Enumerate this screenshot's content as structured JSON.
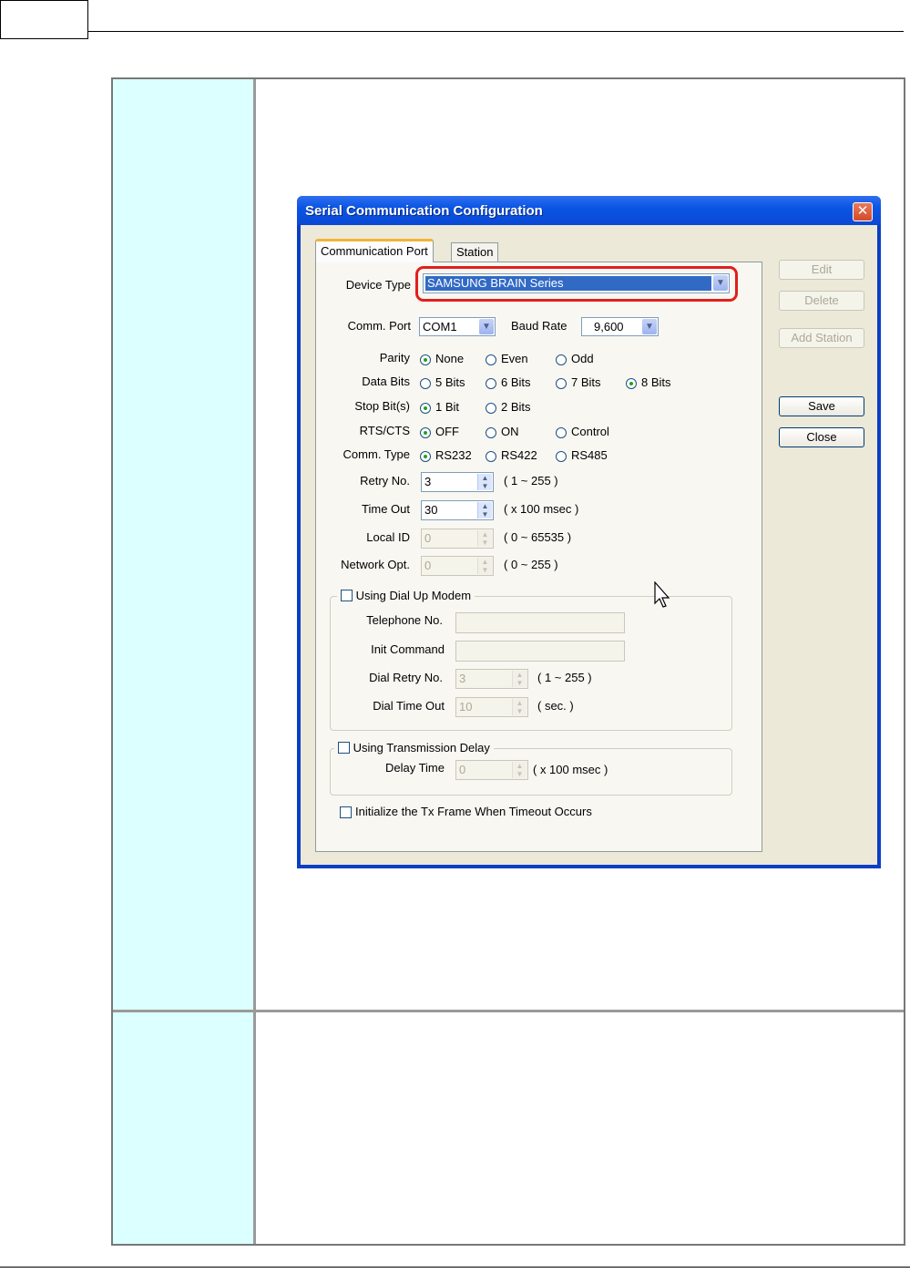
{
  "dialog": {
    "title": "Serial Communication Configuration",
    "close_glyph": "✕",
    "tabs": [
      {
        "label": "Communication Port",
        "active": true
      },
      {
        "label": "Station",
        "active": false
      }
    ],
    "device_type": {
      "label": "Device Type",
      "value": "SAMSUNG BRAIN Series"
    },
    "comm_port": {
      "label": "Comm. Port",
      "value": "COM1"
    },
    "baud_rate": {
      "label": "Baud Rate",
      "value": "9,600"
    },
    "parity": {
      "label": "Parity",
      "options": [
        "None",
        "Even",
        "Odd"
      ],
      "selected": "None"
    },
    "data_bits": {
      "label": "Data Bits",
      "options": [
        "5 Bits",
        "6 Bits",
        "7 Bits",
        "8 Bits"
      ],
      "selected": "8 Bits"
    },
    "stop_bits": {
      "label": "Stop Bit(s)",
      "options": [
        "1 Bit",
        "2 Bits"
      ],
      "selected": "1 Bit"
    },
    "rts_cts": {
      "label": "RTS/CTS",
      "options": [
        "OFF",
        "ON",
        "Control"
      ],
      "selected": "OFF"
    },
    "comm_type": {
      "label": "Comm. Type",
      "options": [
        "RS232",
        "RS422",
        "RS485"
      ],
      "selected": "RS232"
    },
    "retry_no": {
      "label": "Retry No.",
      "value": "3",
      "range": "( 1 ~ 255 )"
    },
    "time_out": {
      "label": "Time Out",
      "value": "30",
      "range": "( x 100 msec )"
    },
    "local_id": {
      "label": "Local ID",
      "value": "0",
      "range": "( 0 ~ 65535 )"
    },
    "network_opt": {
      "label": "Network Opt.",
      "value": "0",
      "range": "( 0 ~ 255 )"
    },
    "dial_modem": {
      "label": "Using Dial Up Modem",
      "telephone_label": "Telephone No.",
      "init_label": "Init Command",
      "dial_retry_label": "Dial Retry No.",
      "dial_retry_value": "3",
      "dial_retry_range": "( 1 ~ 255 )",
      "dial_timeout_label": "Dial Time Out",
      "dial_timeout_value": "10",
      "dial_timeout_range": "( sec. )"
    },
    "tx_delay": {
      "label": "Using Transmission Delay",
      "delay_label": "Delay Time",
      "delay_value": "0",
      "delay_range": "( x 100 msec )"
    },
    "init_tx": {
      "label": "Initialize the Tx Frame When Timeout  Occurs"
    },
    "buttons": {
      "edit": "Edit",
      "delete": "Delete",
      "add_station": "Add Station",
      "save": "Save",
      "close": "Close"
    },
    "glyphs": {
      "dropdown": "▼",
      "spin_up": "▲",
      "spin_down": "▼"
    }
  },
  "colors": {
    "label_cell": "#dcffff",
    "highlight": "#e0201c",
    "titlebar": "#0a55e4"
  }
}
